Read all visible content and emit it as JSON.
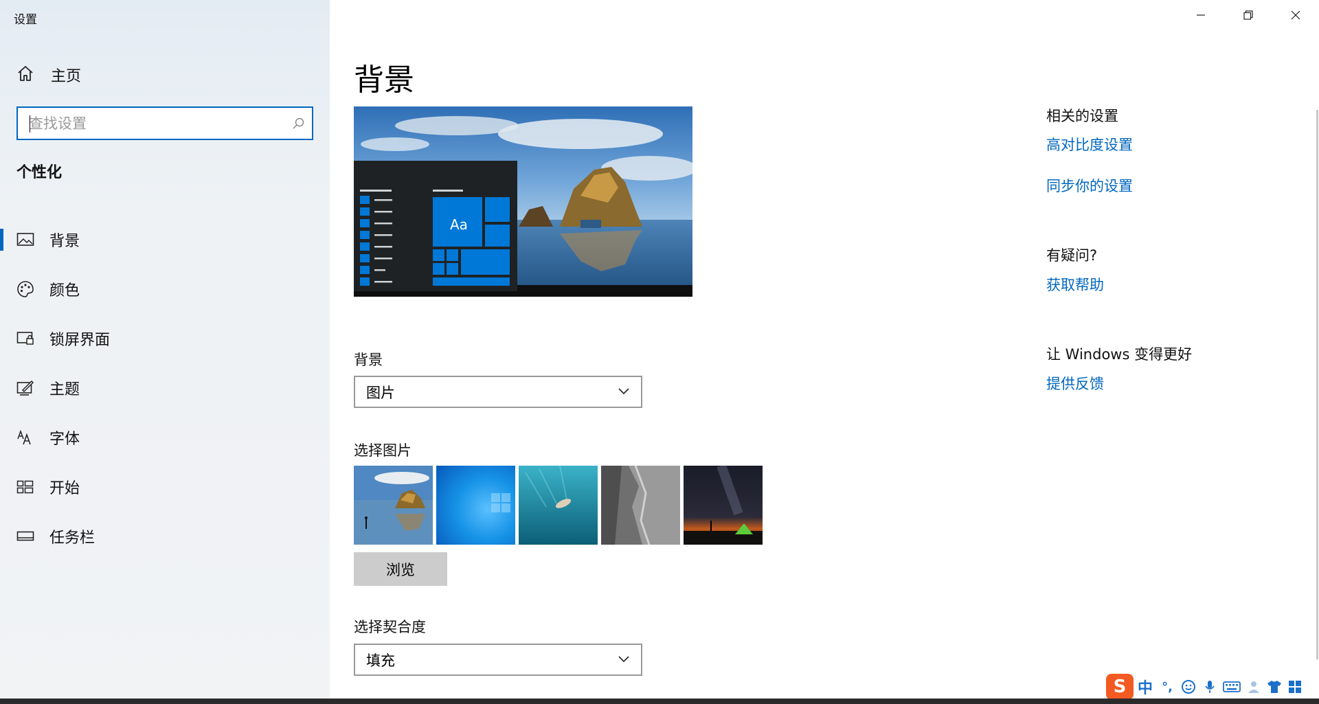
{
  "window": {
    "title": "设置",
    "controls": {
      "minimize": "minimize-icon",
      "restore": "restore-icon",
      "close": "close-icon"
    }
  },
  "sidebar": {
    "home_label": "主页",
    "search_placeholder": "查找设置",
    "section_title": "个性化",
    "items": [
      {
        "label": "背景",
        "icon": "picture-icon",
        "active": true
      },
      {
        "label": "颜色",
        "icon": "palette-icon",
        "active": false
      },
      {
        "label": "锁屏界面",
        "icon": "lock-screen-icon",
        "active": false
      },
      {
        "label": "主题",
        "icon": "theme-brush-icon",
        "active": false
      },
      {
        "label": "字体",
        "icon": "font-icon",
        "active": false
      },
      {
        "label": "开始",
        "icon": "start-tiles-icon",
        "active": false
      },
      {
        "label": "任务栏",
        "icon": "taskbar-icon",
        "active": false
      }
    ]
  },
  "main": {
    "title": "背景",
    "preview_tile_text": "Aa",
    "background_label": "背景",
    "background_value": "图片",
    "choose_picture_label": "选择图片",
    "browse_label": "浏览",
    "fit_label": "选择契合度",
    "fit_value": "填充"
  },
  "related": {
    "title": "相关的设置",
    "links": [
      "高对比度设置",
      "同步你的设置"
    ],
    "question_title": "有疑问?",
    "help_link": "获取帮助",
    "improve_title": "让 Windows 变得更好",
    "feedback_link": "提供反馈"
  },
  "ime": {
    "logo": "S",
    "mode": "中",
    "punct": "°,"
  },
  "colors": {
    "accent": "#0067c0",
    "tile_blue": "#0078d7",
    "sidebar_bg": "#eef2f5"
  }
}
